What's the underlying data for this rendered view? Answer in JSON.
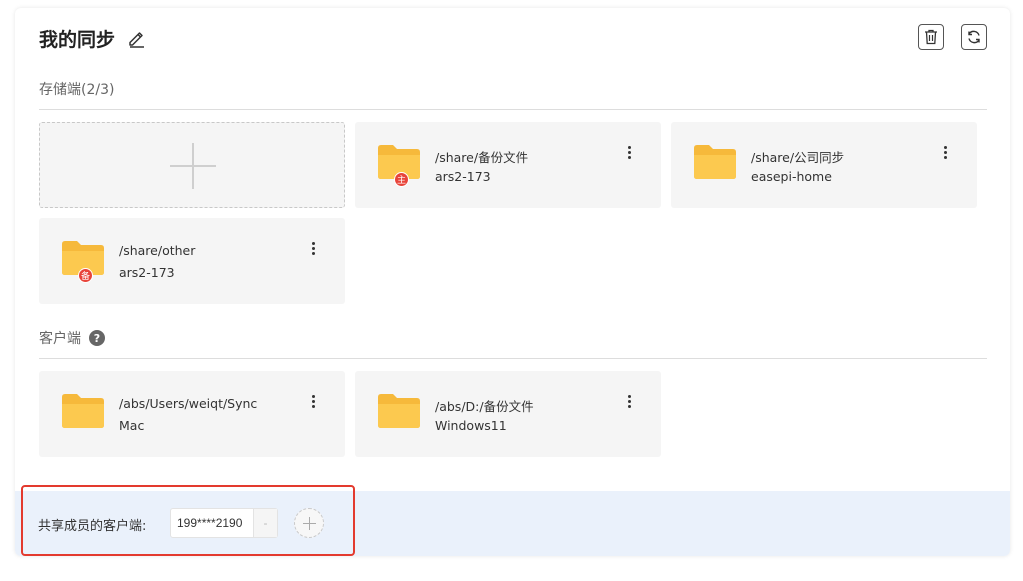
{
  "title": "我的同步",
  "storage": {
    "label": "存储端(2/3)",
    "items": [
      {
        "path": "/share/备份文件",
        "host": "ars2-173",
        "badge": "主"
      },
      {
        "path": "/share/公司同步",
        "host": "easepi-home",
        "badge": ""
      },
      {
        "path": "/share/other",
        "host": "ars2-173",
        "badge": "备"
      }
    ]
  },
  "client": {
    "label": "客户端",
    "items": [
      {
        "path": "/abs/Users/weiqt/Sync",
        "host": "Mac"
      },
      {
        "path": "/abs/D:/备份文件",
        "host": "Windows11"
      }
    ]
  },
  "footer": {
    "label": "共享成员的客户端:",
    "member": "199****2190",
    "remove_symbol": "-"
  },
  "colors": {
    "folder": "#fcc94f",
    "folder_dark": "#f6b93b",
    "badge": "#e8443a",
    "footer_bg": "#eaf1fb",
    "highlight": "#e33a2e"
  },
  "icons": {
    "edit": "pencil-icon",
    "delete": "trash-icon",
    "refresh": "refresh-icon",
    "help": "question-icon",
    "add": "plus-icon",
    "more": "kebab-icon",
    "folder": "folder-icon"
  }
}
